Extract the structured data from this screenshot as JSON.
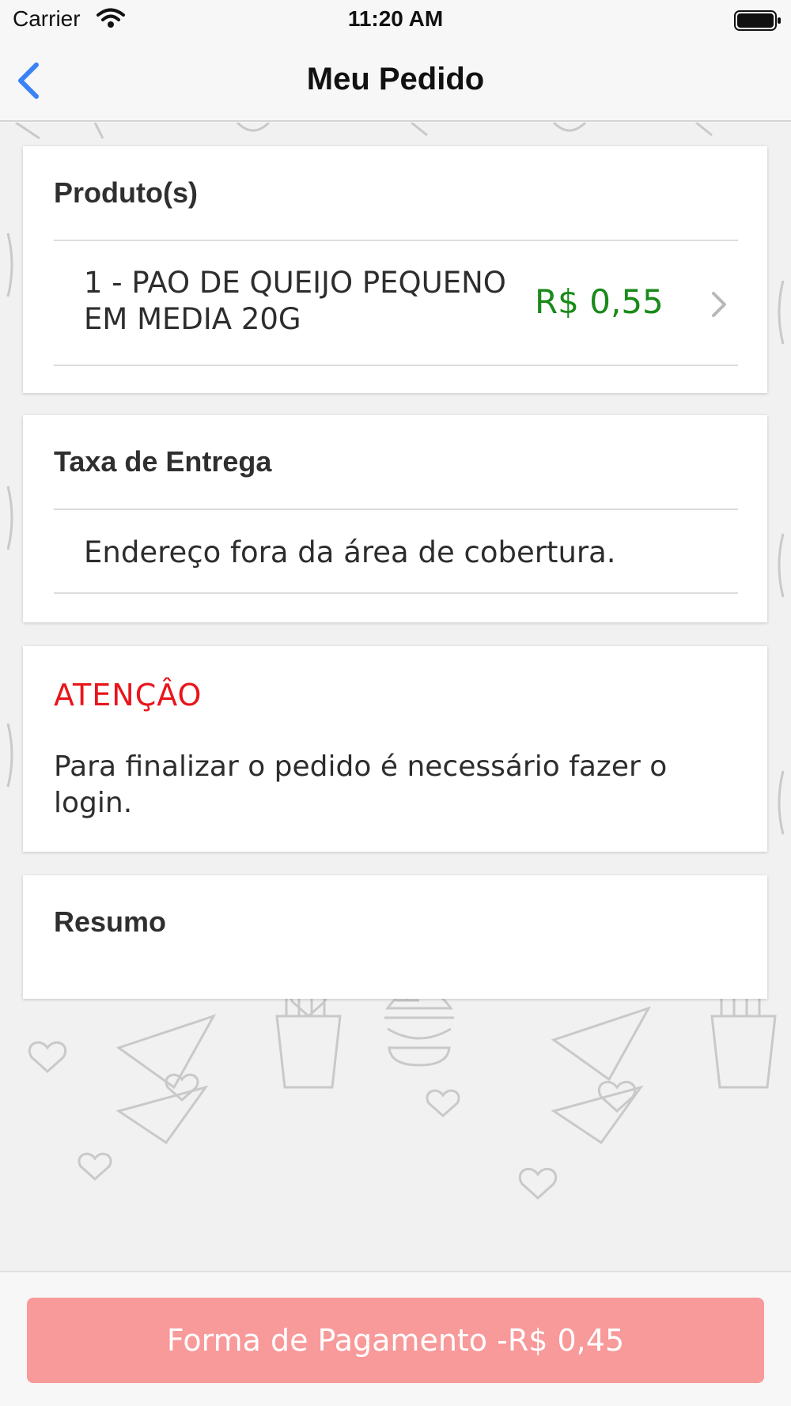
{
  "status_bar": {
    "carrier": "Carrier",
    "time": "11:20 AM",
    "wifi_icon": "wifi-icon",
    "battery_icon": "battery-icon"
  },
  "nav": {
    "title": "Meu Pedido",
    "back_icon": "chevron-left-icon",
    "accent_color": "#3b82f6"
  },
  "products_section": {
    "title": "Produto(s)",
    "items": [
      {
        "name": "1 - PAO DE QUEIJO PEQUENO EM MEDIA 20G",
        "price": "R$ 0,55",
        "price_color": "#1a8a1a"
      }
    ]
  },
  "delivery_section": {
    "title": "Taxa de Entrega",
    "message": "Endereço fora da área de cobertura."
  },
  "warning_section": {
    "title": "ATENÇÂO",
    "title_color": "#e8151b",
    "message": "Para finalizar o pedido é necessário fazer o login."
  },
  "summary_section": {
    "title": "Resumo"
  },
  "footer": {
    "payment_button_label": "Forma de Pagamento -R$ 0,45",
    "button_color": "#f8999a"
  }
}
